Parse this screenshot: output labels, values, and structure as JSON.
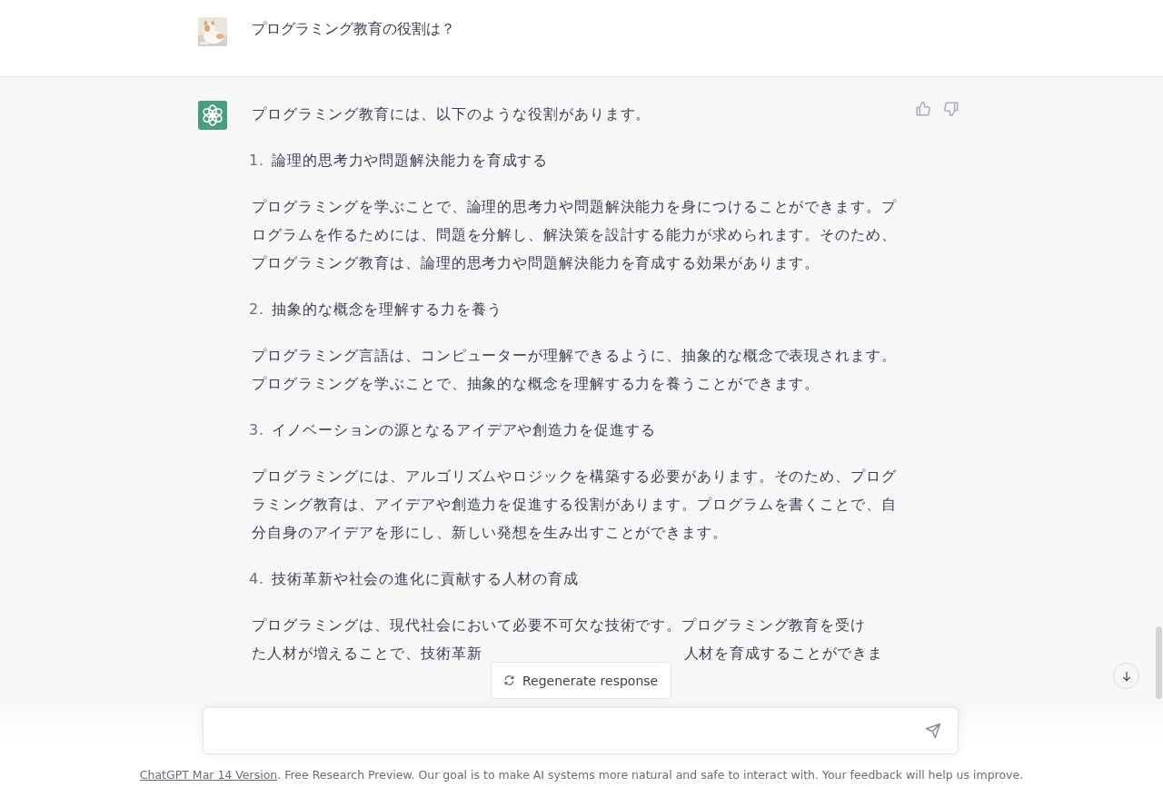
{
  "user_message": {
    "text": "プログラミング教育の役割は？"
  },
  "response": {
    "intro": "プログラミング教育には、以下のような役割があります。",
    "sections": [
      {
        "number": "1.",
        "heading": "論理的思考力や問題解決能力を育成する",
        "paragraph": "プログラミングを学ぶことで、論理的思考力や問題解決能力を身につけることができます。プログラムを作るためには、問題を分解し、解決策を設計する能力が求められます。そのため、プログラミング教育は、論理的思考力や問題解決能力を育成する効果があります。"
      },
      {
        "number": "2.",
        "heading": "抽象的な概念を理解する力を養う",
        "paragraph": "プログラミング言語は、コンピューターが理解できるように、抽象的な概念で表現されます。プログラミングを学ぶことで、抽象的な概念を理解する力を養うことができます。"
      },
      {
        "number": "3.",
        "heading": "イノベーションの源となるアイデアや創造力を促進する",
        "paragraph": "プログラミングには、アルゴリズムやロジックを構築する必要があります。そのため、プログラミング教育は、アイデアや創造力を促進する役割があります。プログラムを書くことで、自分自身のアイデアを形にし、新しい発想を生み出すことができます。"
      },
      {
        "number": "4.",
        "heading": "技術革新や社会の進化に貢献する人材の育成",
        "visible_lines": [
          [
            "プログラミングは、現代社会において必要不可欠な技術です。プログラミング教育を受け"
          ],
          [
            "た人材が増えることで、技術革新",
            "人材を育成することができま"
          ]
        ]
      }
    ]
  },
  "regenerate_button": {
    "label": "Regenerate response"
  },
  "footer": {
    "link": "ChatGPT Mar 14 Version",
    "text": ". Free Research Preview. Our goal is to make AI systems more natural and safe to interact with. Your feedback will help us improve."
  }
}
